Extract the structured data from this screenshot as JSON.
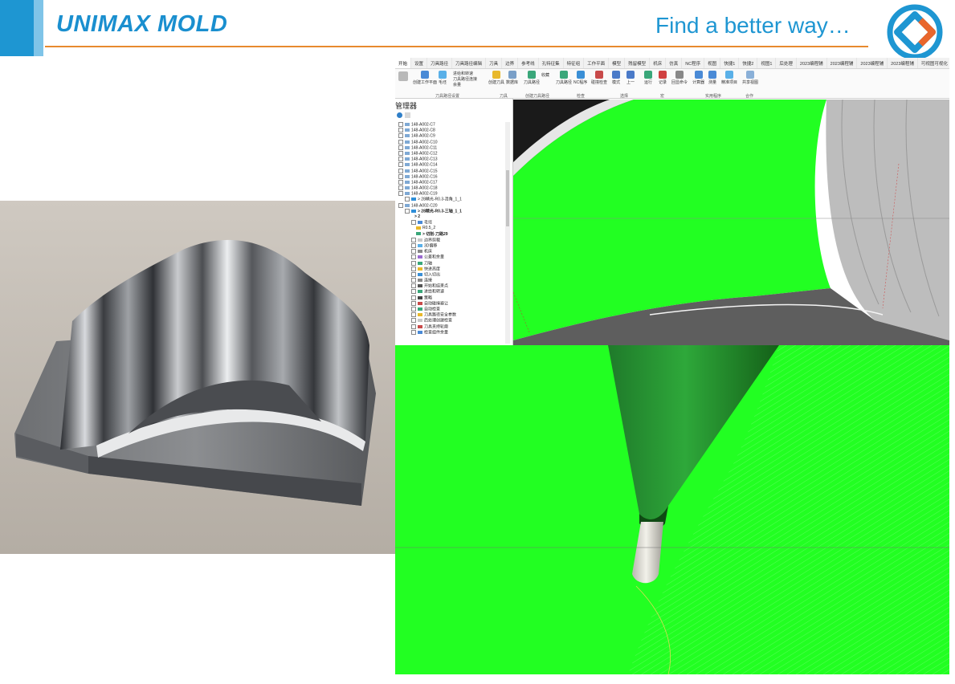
{
  "header": {
    "brand": "UNIMAX MOLD",
    "tagline": "Find a better way…"
  },
  "colors": {
    "brand_blue": "#1e96d2",
    "rule_orange": "#e78a2e",
    "stock_green": "#22ff22"
  },
  "cam": {
    "tabs": [
      "开始",
      "设置",
      "刀具路径",
      "刀具路径编辑",
      "刀具",
      "边界",
      "参考线",
      "孔特征集",
      "特征组",
      "工作平面",
      "模型",
      "残留模型",
      "机床",
      "仿真",
      "NC程序",
      "视图",
      "快捷1",
      "快捷2",
      "视图1",
      "后处理",
      "2023编程辅",
      "2023编程辅",
      "2023编程辅",
      "2023编程辅",
      "可视图可视化"
    ],
    "ribbon_buttons": [
      "创建工作平面",
      "毛坯",
      "进给和转速",
      "刀具路径连接",
      "余量",
      "创建刀具",
      "数据库",
      "刀具路径",
      "收藏",
      "刀具路径",
      "NC程序",
      "碰撞检查",
      "模式",
      "上一",
      "运行",
      "记录",
      "回显命令",
      "计算器",
      "测量",
      "精准项目",
      "共享视图"
    ],
    "ribbon_groups": [
      "刀具路径设置",
      "刀具",
      "创建刀具路径",
      "检查",
      "选择",
      "宏",
      "实用程序",
      "合作"
    ],
    "manager_title": "管理器",
    "tree": [
      "148-A002-C7",
      "148-A002-C8",
      "148-A002-C9",
      "148-A002-C10",
      "148-A002-C11",
      "148-A002-C12",
      "148-A002-C13",
      "148-A002-C14",
      "148-A002-C15",
      "148-A002-C16",
      "148-A002-C17",
      "148-A002-C18",
      "148-A002-C19",
      "> 28精光-R0.3-清角_1_1",
      "148-A002-C20",
      "> 28精光-R0.3-三轴_1_1",
      "> 2",
      "毛坯",
      "R0.5_2",
      "> 切削-刀路29",
      "边界剪裁",
      "3D偏移",
      "机床",
      "公差和余量",
      "刀轴",
      "快进高度",
      "切入切出",
      "连接",
      "开始和结束点",
      "进给和转速",
      "策略",
      "自动碰撞避让",
      "自动检查",
      "刀具路径安全参数",
      "后处理创建检查",
      "刀具夹持轮廓",
      "检查组件余量"
    ]
  }
}
